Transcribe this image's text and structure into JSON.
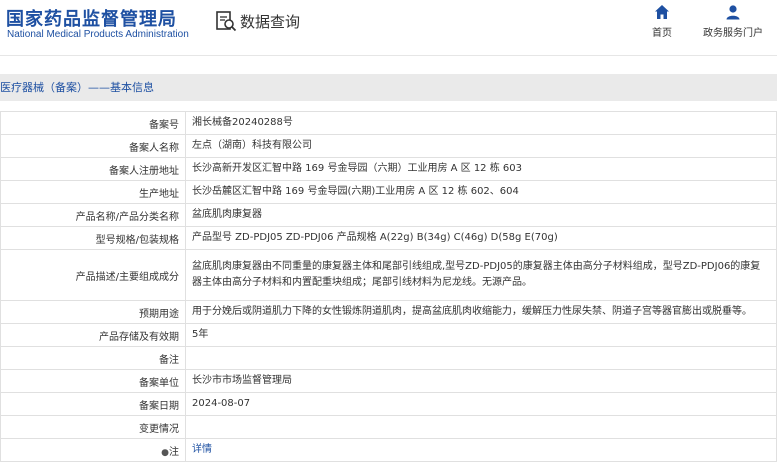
{
  "header": {
    "logo_cn": "国家药品监督管理局",
    "logo_en": "National Medical Products Administration",
    "query_title": "数据查询",
    "nav_home": "首页",
    "nav_portal": "政务服务门户"
  },
  "section_title": "医疗器械（备案）——基本信息",
  "rows": [
    {
      "label": "备案号",
      "value": "湘长械备20240288号"
    },
    {
      "label": "备案人名称",
      "value": "左点（湖南）科技有限公司"
    },
    {
      "label": "备案人注册地址",
      "value": "长沙高新开发区汇智中路 169 号金导园（六期）工业用房 A 区 12 栋 603"
    },
    {
      "label": "生产地址",
      "value": "长沙岳麓区汇智中路 169 号金导园(六期)工业用房 A 区 12 栋 602、604"
    },
    {
      "label": "产品名称/产品分类名称",
      "value": "盆底肌肉康复器"
    },
    {
      "label": "型号规格/包装规格",
      "value": "产品型号 ZD-PDJ05 ZD-PDJ06 产品规格 A(22g) B(34g) C(46g) D(58g E(70g)"
    },
    {
      "label": "产品描述/主要组成成分",
      "value": "盆底肌肉康复器由不同重量的康复器主体和尾部引线组成,型号ZD-PDJ05的康复器主体由高分子材料组成，型号ZD-PDJ06的康复器主体由高分子材料和内置配重块组成；尾部引线材料为尼龙线。无源产品。"
    },
    {
      "label": "预期用途",
      "value": "用于分娩后或阴道肌力下降的女性锻炼阴道肌肉，提高盆底肌肉收缩能力，缓解压力性尿失禁、阴道子宫等器官膨出或脱垂等。"
    },
    {
      "label": "产品存储及有效期",
      "value": "5年"
    },
    {
      "label": "备注",
      "value": ""
    },
    {
      "label": "备案单位",
      "value": "长沙市市场监督管理局"
    },
    {
      "label": "备案日期",
      "value": "2024-08-07"
    },
    {
      "label": "变更情况",
      "value": ""
    }
  ],
  "note_row": {
    "label": "注",
    "link": "详情"
  },
  "icons": {
    "home": "home-icon",
    "portal": "user-icon",
    "query": "search-document-icon",
    "note": "pin-icon"
  },
  "colors": {
    "brand": "#1e50a2",
    "section_bg": "#eaeaea",
    "border": "#e0e0e0"
  }
}
